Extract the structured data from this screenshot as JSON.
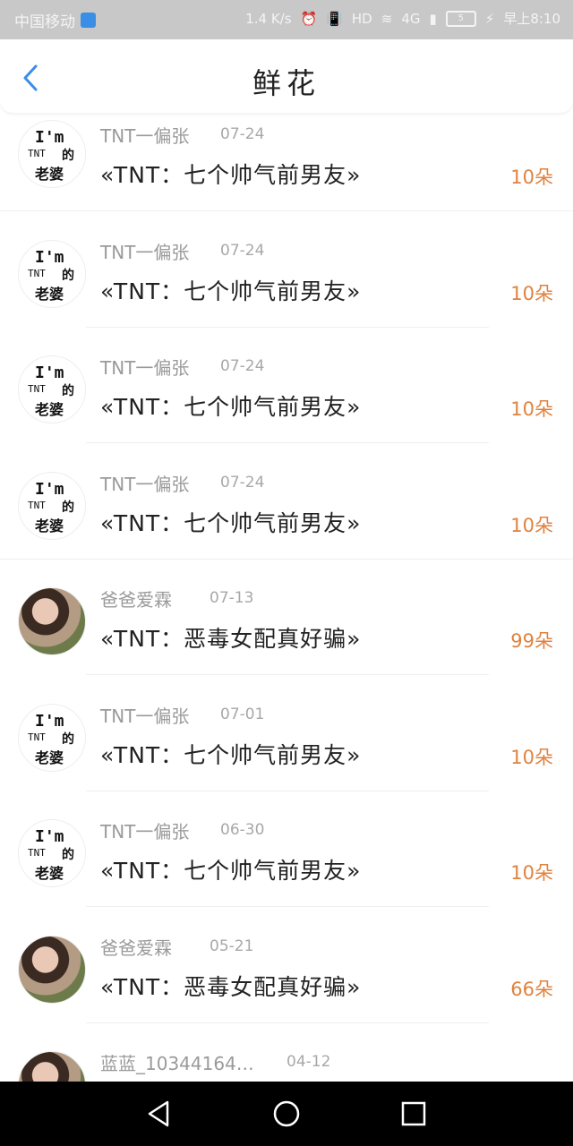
{
  "status_bar": {
    "carrier": "中国移动",
    "speed": "1.4 K/s",
    "network": "4G",
    "battery": "5",
    "time": "早上8:10"
  },
  "header": {
    "title": "鲜花",
    "back_icon": "chevron-left-icon"
  },
  "colors": {
    "accent": "#3a8ee6",
    "count": "#e0823e",
    "muted": "#9a9a9a"
  },
  "items": [
    {
      "name": "TNT一偏张",
      "date": "07-24",
      "title": "«TNT：七个帅气前男友»",
      "count": "10朵",
      "avatar": "text"
    },
    {
      "name": "TNT一偏张",
      "date": "07-24",
      "title": "«TNT：七个帅气前男友»",
      "count": "10朵",
      "avatar": "text"
    },
    {
      "name": "TNT一偏张",
      "date": "07-24",
      "title": "«TNT：七个帅气前男友»",
      "count": "10朵",
      "avatar": "text"
    },
    {
      "name": "TNT一偏张",
      "date": "07-24",
      "title": "«TNT：七个帅气前男友»",
      "count": "10朵",
      "avatar": "text"
    },
    {
      "name": "爸爸爱霖",
      "date": "07-13",
      "title": "«TNT：恶毒女配真好骗»",
      "count": "99朵",
      "avatar": "photo"
    },
    {
      "name": "TNT一偏张",
      "date": "07-01",
      "title": "«TNT：七个帅气前男友»",
      "count": "10朵",
      "avatar": "text"
    },
    {
      "name": "TNT一偏张",
      "date": "06-30",
      "title": "«TNT：七个帅气前男友»",
      "count": "10朵",
      "avatar": "text"
    },
    {
      "name": "爸爸爱霖",
      "date": "05-21",
      "title": "«TNT：恶毒女配真好骗»",
      "count": "66朵",
      "avatar": "photo"
    },
    {
      "name": "蓝蓝_10344164…",
      "date": "04-12",
      "title": "",
      "count": "",
      "avatar": "photo"
    }
  ],
  "avatar_text": {
    "line1": "I'm",
    "line2": "TNT",
    "line3": "的",
    "line4": "老婆"
  },
  "nav": {
    "back": "back-triangle-icon",
    "home": "home-circle-icon",
    "recents": "recents-square-icon"
  }
}
